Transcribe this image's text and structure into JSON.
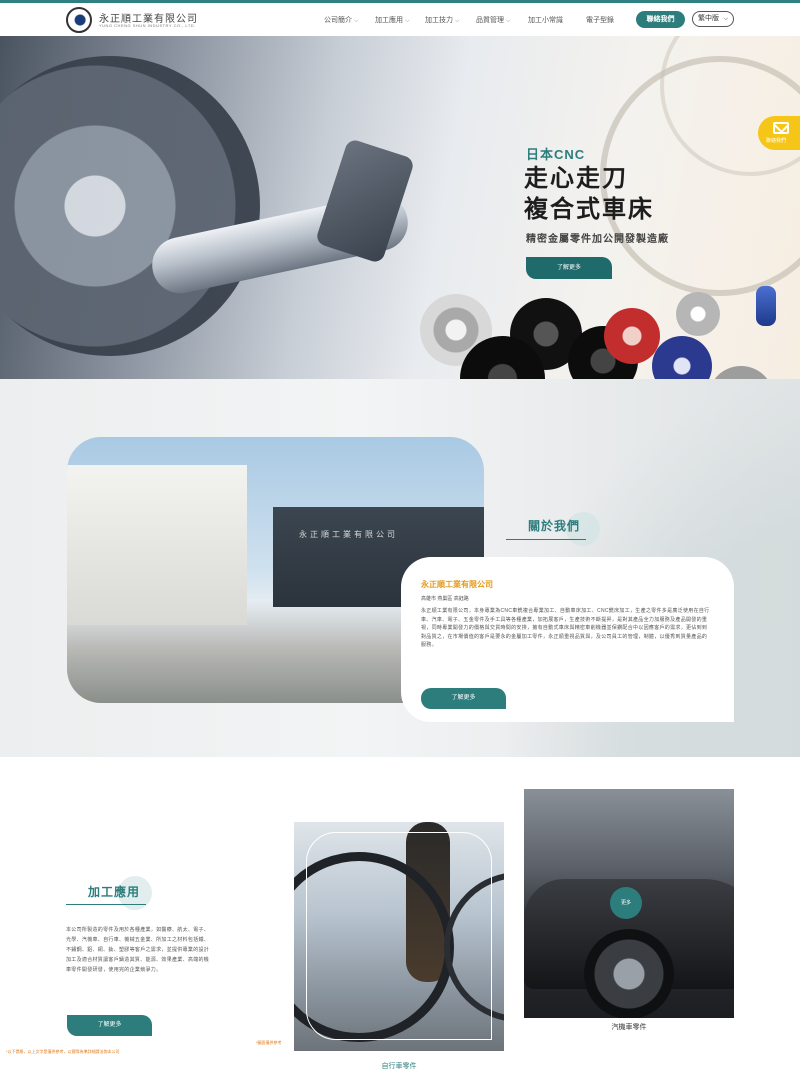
{
  "header": {
    "company_name": "永正順工業有限公司",
    "company_name_en": "YUNG CHENG SHUN INDUSTRY CO., LTD.",
    "nav": [
      {
        "label": "公司簡介",
        "has_dropdown": true
      },
      {
        "label": "加工應用",
        "has_dropdown": true
      },
      {
        "label": "加工技力",
        "has_dropdown": true
      },
      {
        "label": "品質管理",
        "has_dropdown": true
      },
      {
        "label": "加工小常識",
        "has_dropdown": false
      },
      {
        "label": "電子型錄",
        "has_dropdown": false
      }
    ],
    "contact_button": "聯絡我們",
    "language": "繁中版"
  },
  "hero": {
    "subtitle": "日本CNC",
    "title_line1": "走心走刀",
    "title_line2": "複合式車床",
    "description": "精密金屬零件加公開發製造廠",
    "button": "了解更多"
  },
  "floating_contact": {
    "icon": "mail-icon",
    "label": "聯絡我們"
  },
  "about": {
    "heading": "關於我們",
    "building_sign": "永正順工業有限公司",
    "company": "永正順工業有限公司",
    "address": "高雄市 燕巢區 高鈺路",
    "body": "永正順工業有限公司，本身專業為CNC車銑複合專業加工、自動車床加工、CNC銑床加工，生產之零件多是廣泛使用在自行車、汽車、電子、五金零件及手工具等各種產業，加拓展客戶，生產技術不斷提昇，是對其產品全力加服務及產品開發的重視，同時專業開發力的價格與交貨時間的安排，擁有自動式車床與精密車削機器並保鑽配合中以因應客戶的需求，更佔到到對品質之，在市場價值的客戶是要永的金屬加工零件，永正順重視品質與，及公司員工的管理，制體，以優秀到質量產品的服務。",
    "button": "了解更多"
  },
  "applications": {
    "heading": "加工應用",
    "body": "本公司所製造的零件及用於各種產業，如醫療、航太、電子、光學、汽機車、自行車、機械五金業、所加工之材料包括鐵、不鏽鋼、鋁、銅、鈦、塑膠等客戶之需求，並提供專業的設計加工及適合材質讓客戶鑄造其質、能源、效果產業、高端的機車零件開發研發，使用完的企業競爭力。",
    "button": "了解更多",
    "note_left": "*以下價格，以上文字是僅供參考，以實際為準詳細請洽詢本公司",
    "note_right": "*圖面僅供參考",
    "cards": [
      {
        "label": "自行車零件",
        "more": ""
      },
      {
        "label": "汽機車零件",
        "more": "更多"
      }
    ]
  },
  "colors": {
    "accent": "#2d7d7d",
    "highlight": "#f5c518",
    "company_orange": "#e39a1b"
  }
}
